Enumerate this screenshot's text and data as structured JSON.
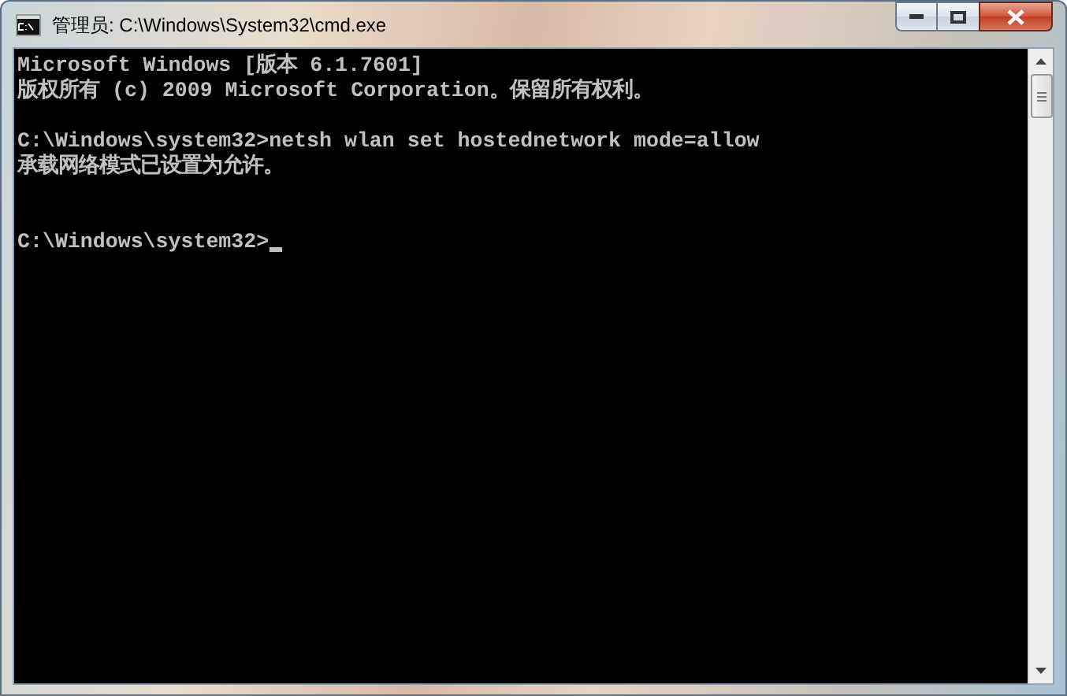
{
  "window": {
    "title": "管理员: C:\\Windows\\System32\\cmd.exe"
  },
  "console": {
    "blocks": [
      {
        "kind": "output",
        "lines": [
          "Microsoft Windows [版本 6.1.7601]",
          "版权所有 (c) 2009 Microsoft Corporation。保留所有权利。"
        ]
      },
      {
        "kind": "output",
        "lines": [
          "C:\\Windows\\system32>netsh wlan set hostednetwork mode=allow",
          "承载网络模式已设置为允许。"
        ]
      },
      {
        "kind": "prompt",
        "lines": [
          "C:\\Windows\\system32>"
        ],
        "cursor": true
      }
    ]
  }
}
